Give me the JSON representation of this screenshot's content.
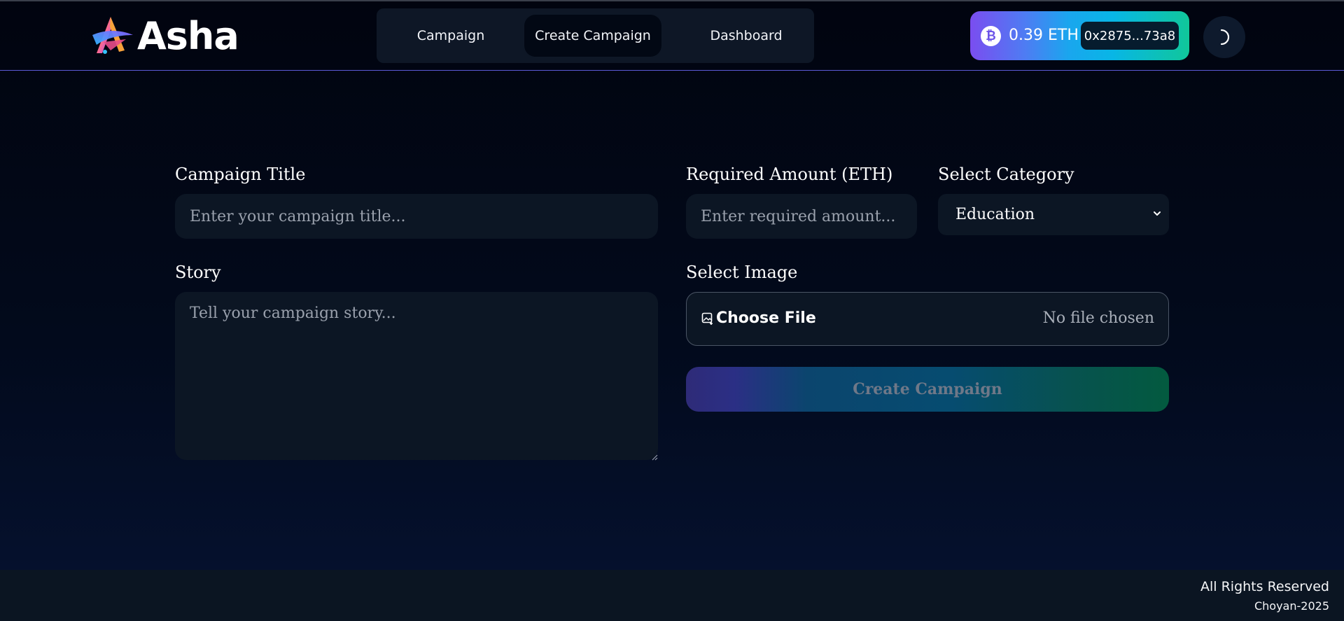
{
  "brand": {
    "name": "Asha",
    "logo_icon": "star-logo-icon"
  },
  "nav": {
    "items": [
      {
        "label": "Campaign",
        "active": false
      },
      {
        "label": "Create Campaign",
        "active": true
      },
      {
        "label": "Dashboard",
        "active": false
      }
    ]
  },
  "wallet": {
    "coin_icon": "bitcoin-icon",
    "coin_symbol": "₿",
    "balance": "0.39 ETH",
    "address": "0x2875...73a8"
  },
  "theme_toggle": {
    "icon": "moon-icon"
  },
  "form": {
    "title": {
      "label": "Campaign Title",
      "placeholder": "Enter your campaign title..."
    },
    "amount": {
      "label": "Required Amount (ETH)",
      "placeholder": "Enter required amount..."
    },
    "category": {
      "label": "Select Category",
      "selected": "Education"
    },
    "story": {
      "label": "Story",
      "placeholder": "Tell your campaign story..."
    },
    "image": {
      "label": "Select Image",
      "button_label": "Choose File",
      "status": "No file chosen",
      "icon": "image-upload-icon"
    },
    "submit_label": "Create Campaign"
  },
  "footer": {
    "rights": "All Rights Reserved",
    "credit": "Choyan-2025"
  },
  "colors": {
    "background": "#01040f",
    "panel": "#0c1624",
    "header_border": "#5b5bd6",
    "wallet_gradient_start": "#7a4df0",
    "wallet_gradient_end": "#10c79a"
  }
}
